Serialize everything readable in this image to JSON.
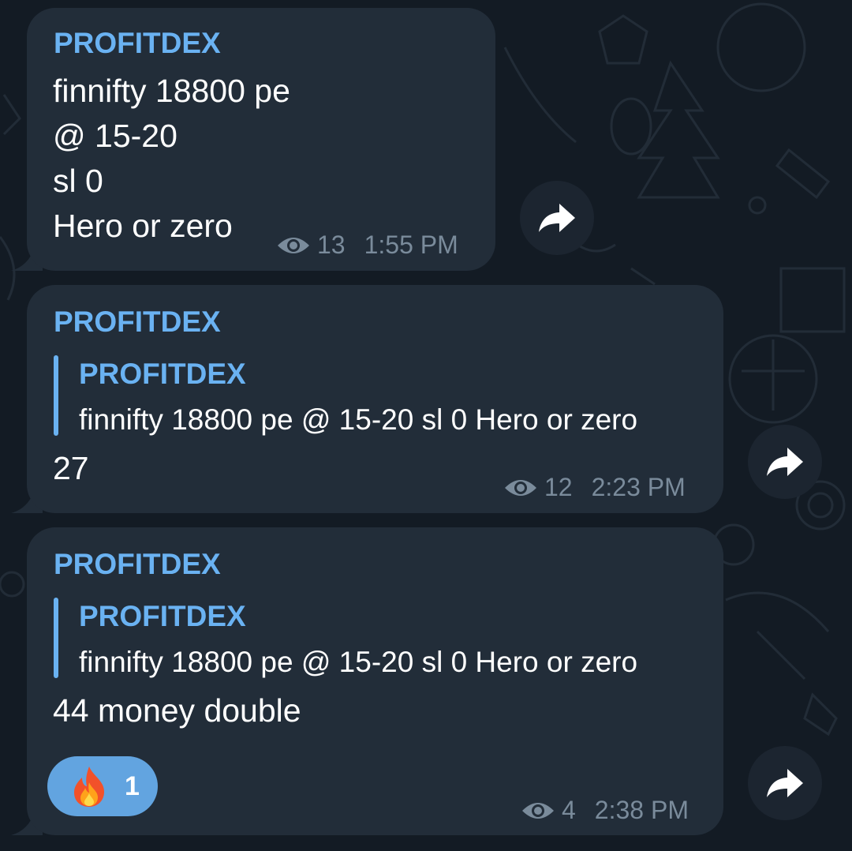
{
  "colors": {
    "background": "#131b24",
    "bubble": "#222d39",
    "accent": "#6ab2f2",
    "meta_text": "#7a8b9b",
    "reaction_bg": "#62a4e0"
  },
  "messages": [
    {
      "sender": "PROFITDEX",
      "lines": [
        "finnifty 18800 pe",
        "@ 15-20",
        "sl 0",
        "Hero or zero"
      ],
      "views": "13",
      "time": "1:55 PM",
      "icons": {
        "views": "eye-icon",
        "forward": "share-arrow-icon"
      }
    },
    {
      "sender": "PROFITDEX",
      "reply": {
        "sender": "PROFITDEX",
        "text": "finnifty 18800 pe @ 15-20 sl 0 Hero or zero"
      },
      "text": "27",
      "views": "12",
      "time": "2:23 PM",
      "icons": {
        "views": "eye-icon",
        "forward": "share-arrow-icon"
      }
    },
    {
      "sender": "PROFITDEX",
      "reply": {
        "sender": "PROFITDEX",
        "text": "finnifty 18800 pe @ 15-20 sl 0 Hero or zero"
      },
      "text": "44 money double",
      "reaction": {
        "icon": "fire-emoji-icon",
        "count": "1"
      },
      "views": "4",
      "time": "2:38 PM",
      "icons": {
        "views": "eye-icon",
        "forward": "share-arrow-icon"
      }
    }
  ]
}
